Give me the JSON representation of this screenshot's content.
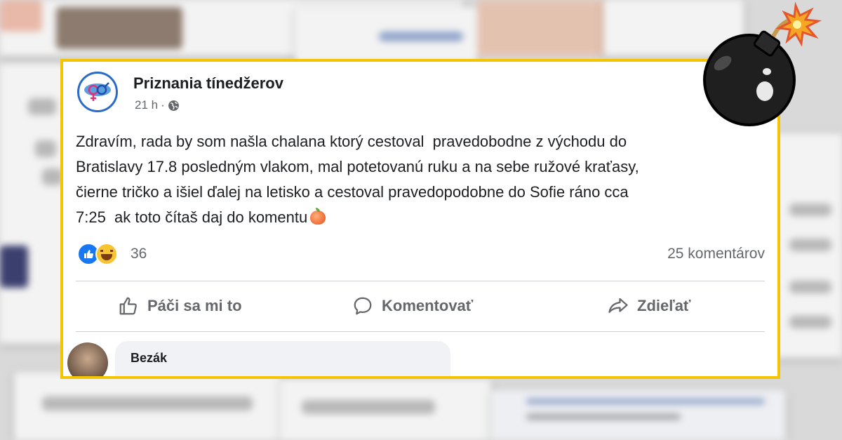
{
  "post": {
    "page_name": "Priznania tínedžerov",
    "time": "21 h",
    "separator": "·",
    "audience_icon": "globe-icon",
    "text": "Zdravím, rada by som našla chalana ktorý cestoval  pravedobodne z východu do\nBratislavy 17.8 posledným vlakom, mal potetovanú ruku a na sebe ružové kraťasy,\nčierne tričko a išiel ďalej na letisko a cestoval pravedopodobne do Sofie ráno cca\n7:25  ak toto čítaš daj do komentu",
    "text_emoji": "peach-icon",
    "reactions": {
      "icons": [
        "like-icon",
        "haha-icon"
      ],
      "count": "36"
    },
    "comments_count": "25 komentárov",
    "actions": {
      "like": "Páči sa mi to",
      "comment": "Komentovať",
      "share": "Zdieľať"
    }
  },
  "comment": {
    "author": "Bezák"
  },
  "colors": {
    "frame": "#f5c400",
    "fb_blue": "#1877f2",
    "text_secondary": "#65676b"
  }
}
